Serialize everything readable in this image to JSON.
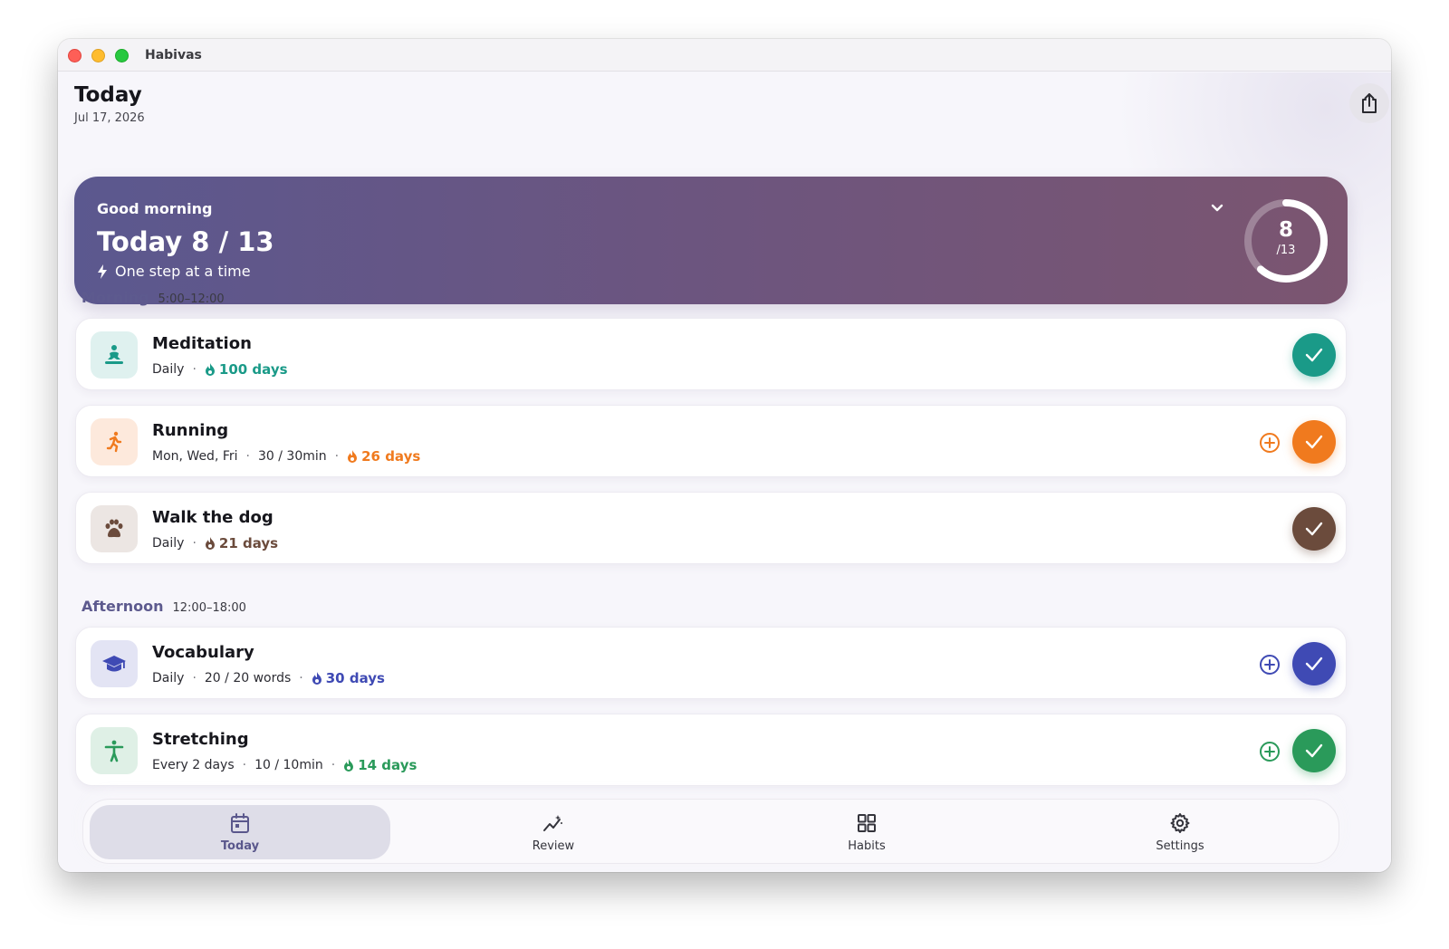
{
  "window": {
    "title": "Habivas"
  },
  "header": {
    "title": "Today",
    "date": "Jul 17, 2026",
    "share_icon": "share-icon"
  },
  "hero": {
    "greeting": "Good morning",
    "progress_text": "Today 8 / 13",
    "subtitle": "One step at a time",
    "ring_done": "8",
    "ring_total": "/13",
    "progress_fraction": 0.615
  },
  "sections": [
    {
      "name": "Morning",
      "time": "5:00–12:00",
      "habits": [
        {
          "name": "Meditation",
          "meta": [
            "Daily"
          ],
          "streak": "100 days",
          "icon": "meditation-icon",
          "color": "#1a9a88",
          "tint": "#dff1ef",
          "has_plus": false,
          "done": true
        },
        {
          "name": "Running",
          "meta": [
            "Mon, Wed, Fri",
            "30 / 30min"
          ],
          "streak": "26 days",
          "icon": "running-icon",
          "color": "#f07a1e",
          "tint": "#fde9dc",
          "has_plus": true,
          "done": true
        },
        {
          "name": "Walk the dog",
          "meta": [
            "Daily"
          ],
          "streak": "21 days",
          "icon": "paw-icon",
          "color": "#6b4b3c",
          "tint": "#ece6e3",
          "has_plus": false,
          "done": true
        }
      ]
    },
    {
      "name": "Afternoon",
      "time": "12:00–18:00",
      "habits": [
        {
          "name": "Vocabulary",
          "meta": [
            "Daily",
            "20 / 20 words"
          ],
          "streak": "30 days",
          "icon": "graduation-cap-icon",
          "color": "#3f4ab4",
          "tint": "#e3e4f4",
          "has_plus": true,
          "done": true
        },
        {
          "name": "Stretching",
          "meta": [
            "Every 2 days",
            "10 / 10min"
          ],
          "streak": "14 days",
          "icon": "stretching-icon",
          "color": "#2a9a5a",
          "tint": "#dff0e6",
          "has_plus": true,
          "done": true
        }
      ]
    }
  ],
  "nav": [
    {
      "label": "Today",
      "icon": "calendar-icon",
      "active": true
    },
    {
      "label": "Review",
      "icon": "review-icon",
      "active": false
    },
    {
      "label": "Habits",
      "icon": "grid-icon",
      "active": false
    },
    {
      "label": "Settings",
      "icon": "gear-icon",
      "active": false
    }
  ]
}
